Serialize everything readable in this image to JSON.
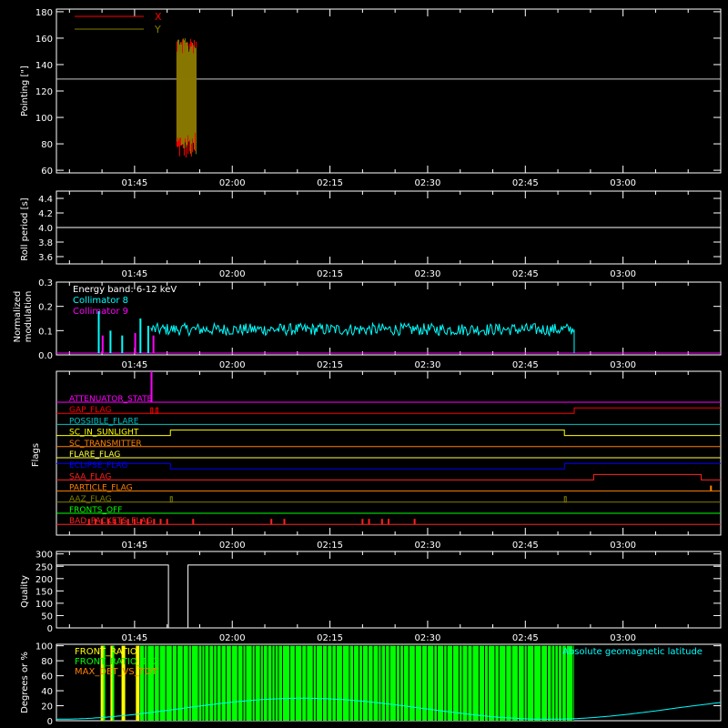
{
  "time_ticks": [
    "01:45",
    "02:00",
    "02:15",
    "02:30",
    "02:45",
    "03:00"
  ],
  "time_tick_minutes": [
    105,
    120,
    135,
    150,
    165,
    180
  ],
  "time_range_minutes": [
    93,
    195
  ],
  "panels": {
    "pointing": {
      "ylabel": "Pointing [\"]",
      "ylim": [
        58,
        182
      ],
      "yticks": [
        "60",
        "80",
        "100",
        "120",
        "140",
        "160",
        "180"
      ],
      "ytick_values": [
        60,
        80,
        100,
        120,
        140,
        160,
        180
      ],
      "reference_line": 129,
      "legend": [
        {
          "name": "X",
          "color": "#ff0000"
        },
        {
          "name": "Y",
          "color": "#808000"
        }
      ],
      "burst": {
        "start": 111.5,
        "end": 114.5,
        "x_range": [
          68,
          162
        ],
        "y_range": [
          72,
          160
        ]
      }
    },
    "roll": {
      "ylabel": "Roll period [s]",
      "ylim": [
        3.5,
        4.5
      ],
      "yticks": [
        "3.6",
        "3.8",
        "4.0",
        "4.2",
        "4.4"
      ],
      "ytick_values": [
        3.6,
        3.8,
        4.0,
        4.2,
        4.4
      ],
      "value": 4.0
    },
    "modulation": {
      "ylabel_line1": "Normalized",
      "ylabel_line2": "modulation",
      "ylim": [
        0,
        0.3
      ],
      "yticks": [
        "0.0",
        "0.1",
        "0.2",
        "0.3"
      ],
      "ytick_values": [
        0,
        0.1,
        0.2,
        0.3
      ],
      "legend": [
        {
          "name": "Energy band: 6-12 keV",
          "color": "#ffffff"
        },
        {
          "name": "Collimator 8",
          "color": "#00ffff"
        },
        {
          "name": "Collimator 9",
          "color": "#ff00ff"
        }
      ],
      "spikes_c8": [
        [
          99.5,
          0.18
        ],
        [
          101.3,
          0.1
        ],
        [
          103.1,
          0.08
        ],
        [
          105.9,
          0.15
        ],
        [
          107.1,
          0.12
        ]
      ],
      "spikes_c9": [
        [
          100.1,
          0.08
        ],
        [
          105.1,
          0.09
        ],
        [
          107.9,
          0.08
        ]
      ],
      "noise": {
        "start": 107.5,
        "end": 172.5,
        "mean": 0.105,
        "amp": 0.025
      }
    },
    "flags": {
      "ylabel": "Flags",
      "rows": [
        {
          "name": "ATTENUATOR_STATE",
          "color": "#ff00ff",
          "steps": []
        },
        {
          "name": "GAP_FLAG",
          "color": "#ff0000",
          "steps": [
            [
              172.5,
              1
            ]
          ]
        },
        {
          "name": "POSSIBLE_FLARE",
          "color": "#00c0c0",
          "steps": []
        },
        {
          "name": "SC_IN_SUNLIGHT",
          "color": "#ffff00",
          "steps": [
            [
              110.5,
              1
            ],
            [
              171,
              0
            ]
          ]
        },
        {
          "name": "SC_TRANSMITTER",
          "color": "#ff8000",
          "steps": []
        },
        {
          "name": "FLARE_FLAG",
          "color": "#ffff40",
          "steps": []
        },
        {
          "name": "ECLIPSE_FLAG",
          "color": "#0000ff",
          "steps": [
            [
              110.5,
              0
            ],
            [
              171,
              1
            ]
          ]
        },
        {
          "name": "SAA_FLAG",
          "color": "#ff2020",
          "steps": [
            [
              175.5,
              1
            ],
            [
              192,
              0
            ]
          ]
        },
        {
          "name": "PARTICLE_FLAG",
          "color": "#ff8000",
          "steps": []
        },
        {
          "name": "AAZ_FLAG",
          "color": "#808000",
          "steps": []
        },
        {
          "name": "FRONTS_OFF",
          "color": "#00ff00",
          "steps": []
        },
        {
          "name": "BAD_PACKETS_FLAG",
          "color": "#ff2020",
          "steps": []
        }
      ],
      "bad_packet_times": [
        98,
        99,
        100,
        101,
        102,
        103,
        104,
        105,
        106,
        107,
        108,
        109,
        110,
        114,
        126,
        128,
        140,
        141,
        143,
        144,
        148
      ]
    },
    "quality": {
      "ylabel": "Quality",
      "ylim": [
        0,
        310
      ],
      "yticks": [
        "0",
        "50",
        "100",
        "150",
        "200",
        "250",
        "300"
      ],
      "ytick_values": [
        0,
        50,
        100,
        150,
        200,
        250,
        300
      ],
      "segments": [
        [
          93,
          110.2,
          255
        ],
        [
          110.2,
          113.2,
          0
        ],
        [
          113.2,
          195,
          255
        ]
      ]
    },
    "geomag": {
      "ylabel": "Degrees or %",
      "ylim": [
        0,
        102
      ],
      "yticks": [
        "0",
        "20",
        "40",
        "60",
        "80",
        "100"
      ],
      "ytick_values": [
        0,
        20,
        40,
        60,
        80,
        100
      ],
      "legend": [
        {
          "name": "FRONT_RATIO",
          "color": "#ffff00"
        },
        {
          "name": "FRONT_RATIO_1225",
          "color": "#00ff00"
        },
        {
          "name": "MAX_DET_VS_TOT",
          "color": "#ff8000"
        }
      ],
      "latitude_label": "Absolute geomagnetic latitude",
      "latitude_color": "#00ffff",
      "green_region": [
        105.5,
        172.5
      ]
    }
  },
  "colors": {
    "axis": "#ffffff",
    "background": "#000000"
  }
}
